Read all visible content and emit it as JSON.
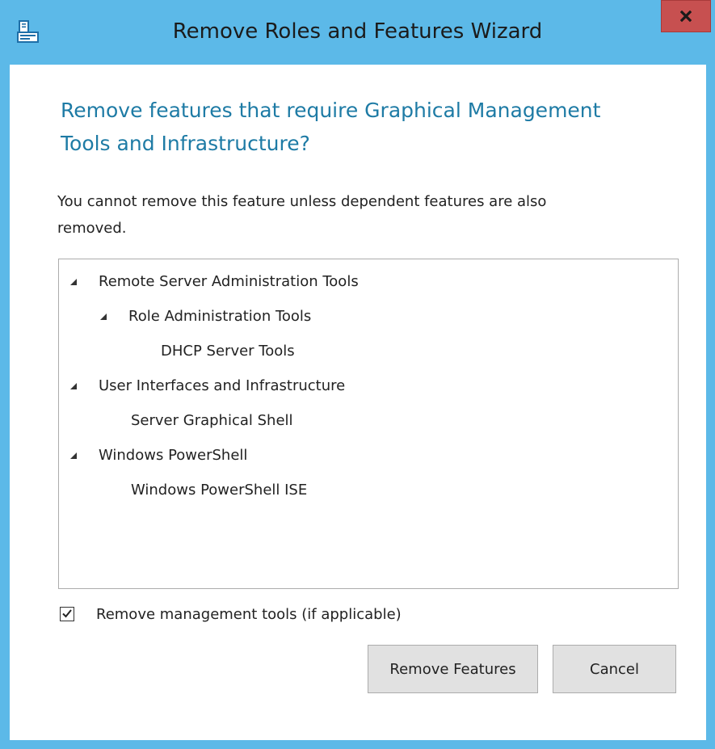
{
  "window": {
    "title": "Remove Roles and Features Wizard",
    "close_symbol": "x",
    "app_icon": "server-manager-icon",
    "close_icon": "close-icon"
  },
  "dialog": {
    "heading_line1": "Remove features that require Graphical Management",
    "heading_line2": "Tools and Infrastructure?",
    "description_line1": "You cannot remove this feature unless dependent features are also",
    "description_line2": "removed."
  },
  "tree": {
    "items": [
      {
        "label": "Remote Server Administration Tools",
        "level": 0,
        "expanded": true
      },
      {
        "label": "Role Administration Tools",
        "level": 1,
        "expanded": true
      },
      {
        "label": "DHCP Server Tools",
        "level": 2,
        "expanded": false
      },
      {
        "label": "User Interfaces and Infrastructure",
        "level": 0,
        "expanded": true
      },
      {
        "label": "Server Graphical Shell",
        "level": 1,
        "expanded": false
      },
      {
        "label": "Windows PowerShell",
        "level": 0,
        "expanded": true
      },
      {
        "label": "Windows PowerShell ISE",
        "level": 1,
        "expanded": false
      }
    ]
  },
  "options": {
    "remove_tools_label": "Remove management tools (if applicable)",
    "remove_tools_checked": true
  },
  "buttons": {
    "remove_label": "Remove Features",
    "cancel_label": "Cancel"
  },
  "colors": {
    "window_frame": "#5cb9e8",
    "heading_text": "#1e7ba5",
    "close_button": "#c75050",
    "button_face": "#e1e1e1"
  }
}
